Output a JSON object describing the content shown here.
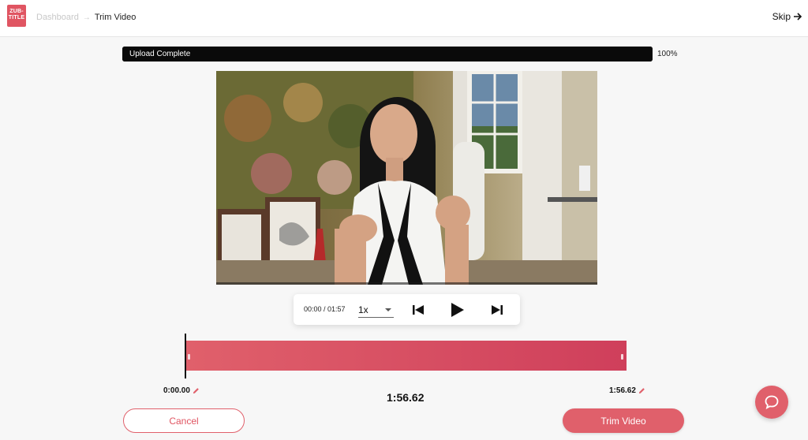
{
  "header": {
    "logo_line1": "ZUB-",
    "logo_line2": "TITLE",
    "breadcrumb": {
      "dashboard": "Dashboard",
      "current": "Trim Video"
    },
    "skip_label": "Skip"
  },
  "upload": {
    "status_label": "Upload Complete",
    "percent_label": "100%",
    "progress_fraction": 1.0
  },
  "player": {
    "time_readout": "00:00 / 01:57",
    "speed": "1x"
  },
  "trim": {
    "start_label": "0:00.00",
    "end_label": "1:56.62",
    "duration_label": "1:56.62"
  },
  "actions": {
    "cancel_label": "Cancel",
    "trim_label": "Trim Video"
  },
  "colors": {
    "accent": "#e0606b",
    "accent_dark": "#cf3f5b",
    "progress": "#0a0a0a"
  },
  "icons": {
    "skip": "arrow-right-icon",
    "prev": "skip-previous-icon",
    "play": "play-icon",
    "next": "skip-next-icon",
    "edit": "pencil-icon",
    "chat": "chat-bubble-icon"
  }
}
